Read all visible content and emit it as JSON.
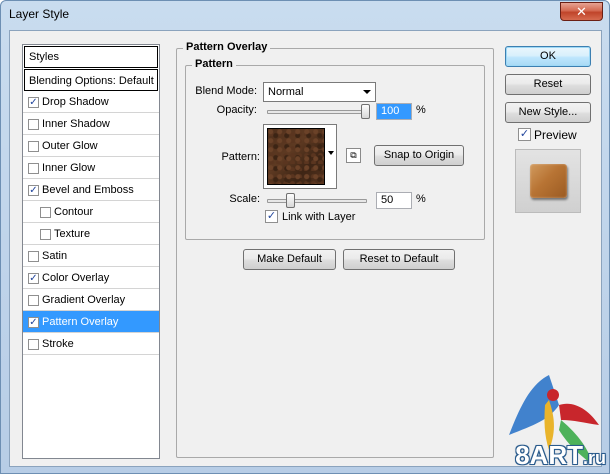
{
  "window": {
    "title": "Layer Style",
    "close_glyph": "✕"
  },
  "sidebar": {
    "header": "Styles",
    "blending": "Blending Options: Default",
    "items": [
      {
        "label": "Drop Shadow",
        "checked": true
      },
      {
        "label": "Inner Shadow",
        "checked": false
      },
      {
        "label": "Outer Glow",
        "checked": false
      },
      {
        "label": "Inner Glow",
        "checked": false
      },
      {
        "label": "Bevel and Emboss",
        "checked": true
      },
      {
        "label": "Contour",
        "checked": false
      },
      {
        "label": "Texture",
        "checked": false
      },
      {
        "label": "Satin",
        "checked": false
      },
      {
        "label": "Color Overlay",
        "checked": true
      },
      {
        "label": "Gradient Overlay",
        "checked": false
      },
      {
        "label": "Pattern Overlay",
        "checked": true
      },
      {
        "label": "Stroke",
        "checked": false
      }
    ],
    "check_glyph": "✓"
  },
  "panel": {
    "group_title": "Pattern Overlay",
    "subgroup_title": "Pattern",
    "blend_mode_label": "Blend Mode:",
    "blend_mode_value": "Normal",
    "opacity_label": "Opacity:",
    "opacity_value": "100",
    "opacity_unit": "%",
    "opacity_fraction": 1.0,
    "pattern_label": "Pattern:",
    "snap_button": "Snap to Origin",
    "scale_label": "Scale:",
    "scale_value": "50",
    "scale_unit": "%",
    "link_label": "Link with Layer",
    "link_checked": true,
    "make_default": "Make Default",
    "reset_default": "Reset to Default"
  },
  "actions": {
    "ok": "OK",
    "reset": "Reset",
    "new_style": "New Style...",
    "preview_label": "Preview",
    "preview_checked": true
  },
  "watermark": {
    "text": "8ART",
    "suffix": ".ru"
  },
  "colors": {
    "accent": "#3399ff",
    "tile": "#b87434"
  }
}
